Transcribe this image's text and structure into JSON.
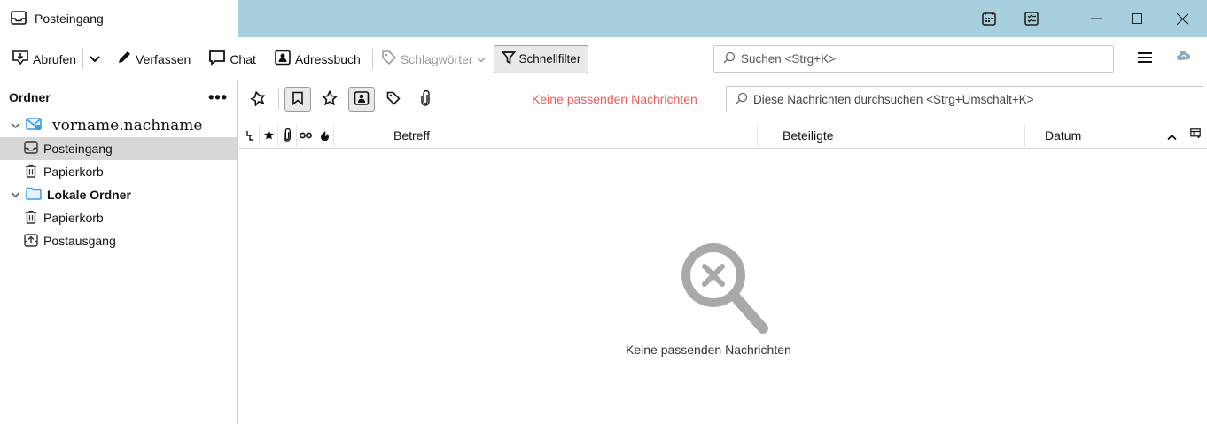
{
  "window": {
    "tab_title": "Posteingang"
  },
  "toolbar": {
    "get_messages": "Abrufen",
    "write": "Verfassen",
    "chat": "Chat",
    "address_book": "Adressbuch",
    "tags": "Schlagwörter",
    "quick_filter": "Schnellfilter",
    "search_placeholder": "Suchen <Strg+K>"
  },
  "folder_pane": {
    "header": "Ordner",
    "account_name": "vorname.nachname",
    "account_folders": [
      "Posteingang",
      "Papierkorb"
    ],
    "local_folders_label": "Lokale Ordner",
    "local_folders": [
      "Papierkorb",
      "Postausgang"
    ]
  },
  "quick_filter_bar": {
    "no_match": "Keine passenden Nachrichten",
    "search_placeholder": "Diese Nachrichten durchsuchen <Strg+Umschalt+K>"
  },
  "thread_columns": {
    "subject": "Betreff",
    "participants": "Beteiligte",
    "date": "Datum"
  },
  "empty_state": {
    "text": "Keine passenden Nachrichten"
  },
  "colors": {
    "titlebar": "#a8cfdd",
    "no_match_text": "#ef5a5a",
    "folder_blue": "#3e9be9"
  }
}
